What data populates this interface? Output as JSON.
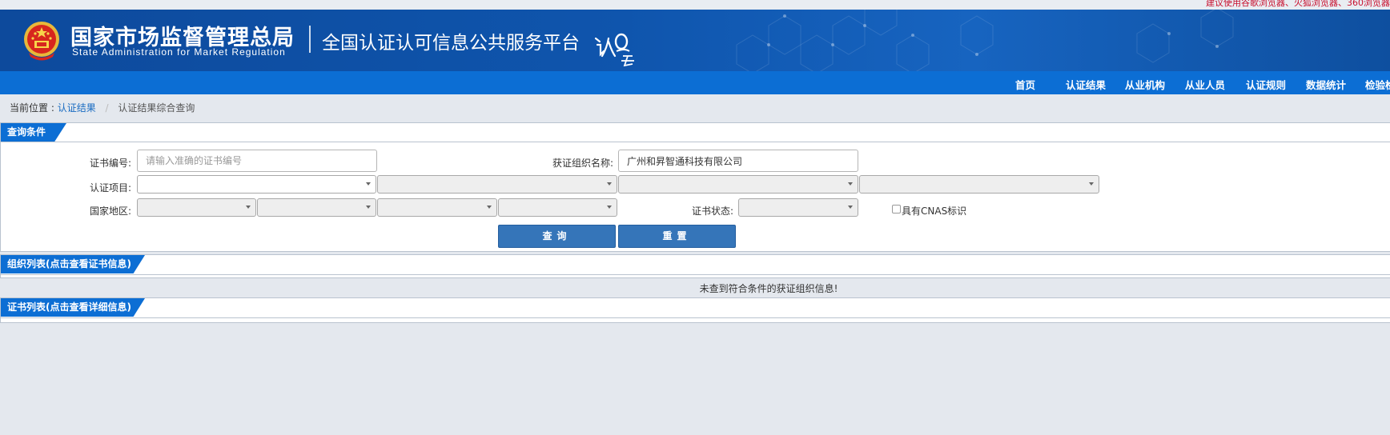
{
  "notice": "建议使用谷歌浏览器、火狐浏览器、360浏览器",
  "header": {
    "agency_cn": "国家市场监督管理总局",
    "agency_en": "State Administration  for  Market Regulation",
    "platform": "全国认证认可信息公共服务平台",
    "logo_text": "认云"
  },
  "nav": {
    "items": [
      "首页",
      "认证结果",
      "从业机构",
      "从业人员",
      "认证规则",
      "数据统计",
      "检验检测"
    ]
  },
  "breadcrumb": {
    "prefix": "当前位置 :",
    "link": "认证结果",
    "current": "认证结果综合查询"
  },
  "query_panel": {
    "title": "查询条件",
    "cert_no_label": "证书编号:",
    "cert_no_placeholder": "请输入准确的证书编号",
    "org_name_label": "获证组织名称:",
    "org_name_value": "广州和昇智通科技有限公司",
    "cert_project_label": "认证项目:",
    "region_label": "国家地区:",
    "status_label": "证书状态:",
    "cnas_label": "具有CNAS标识",
    "query_button": "查询",
    "reset_button": "重置"
  },
  "org_panel": {
    "title": "组织列表(点击查看证书信息)",
    "empty_message": "未查到符合条件的获证组织信息!"
  },
  "cert_panel": {
    "title": "证书列表(点击查看详细信息)"
  },
  "colors": {
    "banner": "#0f55ad",
    "nav": "#0c6ed4",
    "button": "#3575b9",
    "link": "#1a6cc2",
    "notice": "#c8102e"
  }
}
